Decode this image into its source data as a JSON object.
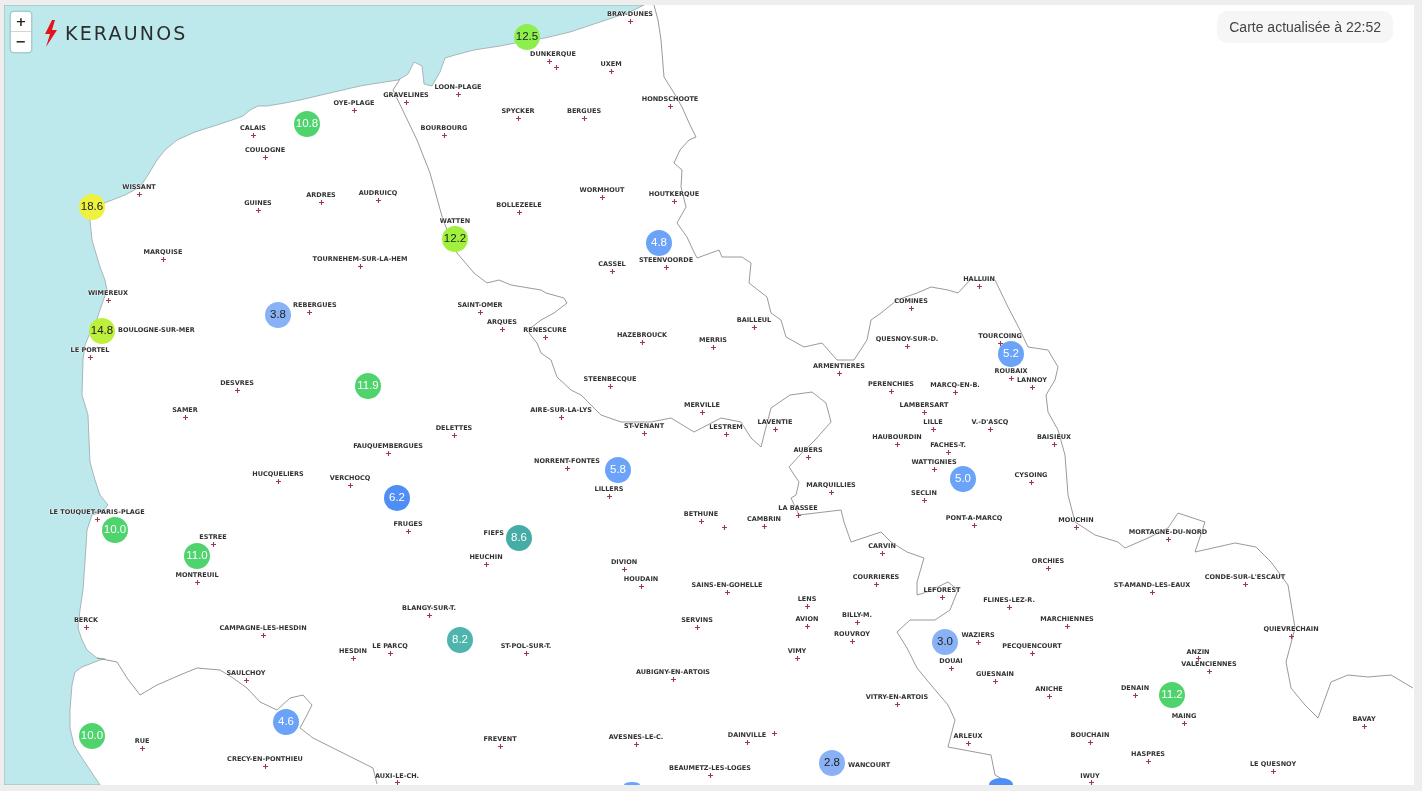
{
  "map_controls": {
    "zoom_in": "+",
    "zoom_out": "−"
  },
  "logo": {
    "text": "KERAUNOS"
  },
  "update_badge": {
    "text": "Carte actualisée à 22:52"
  },
  "map": {
    "towns": [
      "BRAY-DUNES",
      "DUNKERQUE",
      "UXEM",
      "LOON-PLAGE",
      "GRAVELINES",
      "OYE-PLAGE",
      "HONDSCHOOTE",
      "SPYCKER",
      "BERGUES",
      "CALAIS",
      "BOURBOURG",
      "COULOGNE",
      "WISSANT",
      "ARDRES",
      "AUDRUICQ",
      "WORMHOUT",
      "HOUTKERQUE",
      "GUINES",
      "BOLLEZEELE",
      "WATTEN",
      "MARQUISE",
      "TOURNEHEM-SUR-LA-HEM",
      "CASSEL",
      "STEENVOORDE",
      "HALLUIN",
      "WIMEREUX",
      "REBERGUES",
      "SAINT-OMER",
      "COMINES",
      "ARQUES",
      "BAILLEUL",
      "BOULOGNE-SUR-MER",
      "RENESCURE",
      "HAZEBROUCK",
      "MERRIS",
      "QUESNOY-SUR-D.",
      "TOURCOING",
      "LE PORTEL",
      "ARMENTIERES",
      "ROUBAIX",
      "DESVRES",
      "STEENBECQUE",
      "PERENCHIES",
      "MARCQ-EN-B.",
      "LANNOY",
      "SAMER",
      "AIRE-SUR-LA-LYS",
      "MERVILLE",
      "LAMBERSART",
      "DELETTES",
      "ST-VENANT",
      "LESTREM",
      "LAVENTIE",
      "LILLE",
      "V.-D'ASCQ",
      "HAUBOURDIN",
      "BAISIEUX",
      "FAUQUEMBERGUES",
      "AUBERS",
      "FACHES-T.",
      "NORRENT-FONTES",
      "WATTIGNIES",
      "HUCQUELIERS",
      "VERCHOCQ",
      "CYSOING",
      "LILLERS",
      "MARQUILLIES",
      "SECLIN",
      "LE TOUQUET-PARIS-PLAGE",
      "BETHUNE",
      "LA BASSEE",
      "FRUGES",
      "CAMBRIN",
      "PONT-A-MARCQ",
      "MOUCHIN",
      "ESTREE",
      "FIEFS",
      "MORTAGNE-DU-NORD",
      "CARVIN",
      "HEUCHIN",
      "DIVION",
      "ORCHIES",
      "MONTREUIL",
      "HOUDAIN",
      "COURRIERES",
      "CONDE-SUR-L'ESCAUT",
      "SAINS-EN-GOHELLE",
      "LEFOREST",
      "ST-AMAND-LES-EAUX",
      "LENS",
      "FLINES-LEZ-R.",
      "BLANGY-SUR-T.",
      "BERCK",
      "SERVINS",
      "AVION",
      "BILLY-M.",
      "MARCHIENNES",
      "CAMPAGNE-LES-HESDIN",
      "ROUVROY",
      "WAZIERS",
      "QUIEVRECHAIN",
      "HESDIN",
      "LE PARCQ",
      "ST-POL-SUR-T.",
      "VIMY",
      "PECQUENCOURT",
      "ANZIN",
      "DOUAI",
      "VALENCIENNES",
      "SAULCHOY",
      "AUBIGNY-EN-ARTOIS",
      "GUESNAIN",
      "ANICHE",
      "DENAIN",
      "VITRY-EN-ARTOIS",
      "MAING",
      "BAVAY",
      "RUE",
      "FREVENT",
      "AVESNES-LE-C.",
      "DAINVILLE",
      "ARLEUX",
      "BOUCHAIN",
      "CRECY-EN-PONTHIEU",
      "HASPRES",
      "BEAUMETZ-LES-LOGES",
      "WANCOURT",
      "LE QUESNOY",
      "AUXI-LE-CH.",
      "IWUY"
    ],
    "stations": [
      {
        "value": "12.5",
        "color": "#8def4e"
      },
      {
        "value": "10.8",
        "color": "#4fd46d"
      },
      {
        "value": "18.6",
        "color": "#eef23f"
      },
      {
        "value": "12.2",
        "color": "#a1f03b"
      },
      {
        "value": "4.8",
        "color": "#6aa3f8"
      },
      {
        "value": "14.8",
        "color": "#bcf03d"
      },
      {
        "value": "3.8",
        "color": "#89b2f6"
      },
      {
        "value": "5.2",
        "color": "#6aa3f8"
      },
      {
        "value": "11.9",
        "color": "#4fd46d"
      },
      {
        "value": "5.8",
        "color": "#6aa3f8"
      },
      {
        "value": "6.2",
        "color": "#4f8ef5"
      },
      {
        "value": "5.0",
        "color": "#6aa3f8"
      },
      {
        "value": "10.0",
        "color": "#4fd46d"
      },
      {
        "value": "11.0",
        "color": "#4fd46d"
      },
      {
        "value": "8.6",
        "color": "#45aca6"
      },
      {
        "value": "8.2",
        "color": "#4fb4ae"
      },
      {
        "value": "3.0",
        "color": "#89b2f6"
      },
      {
        "value": "11.2",
        "color": "#4fd46d"
      },
      {
        "value": "10.0",
        "color": "#4fd46d"
      },
      {
        "value": "4.6",
        "color": "#6aa3f8"
      },
      {
        "value": "2.8",
        "color": "#89b2f6"
      },
      {
        "color": "#6aa3f8"
      },
      {
        "color": "#4f8ef5"
      }
    ]
  }
}
